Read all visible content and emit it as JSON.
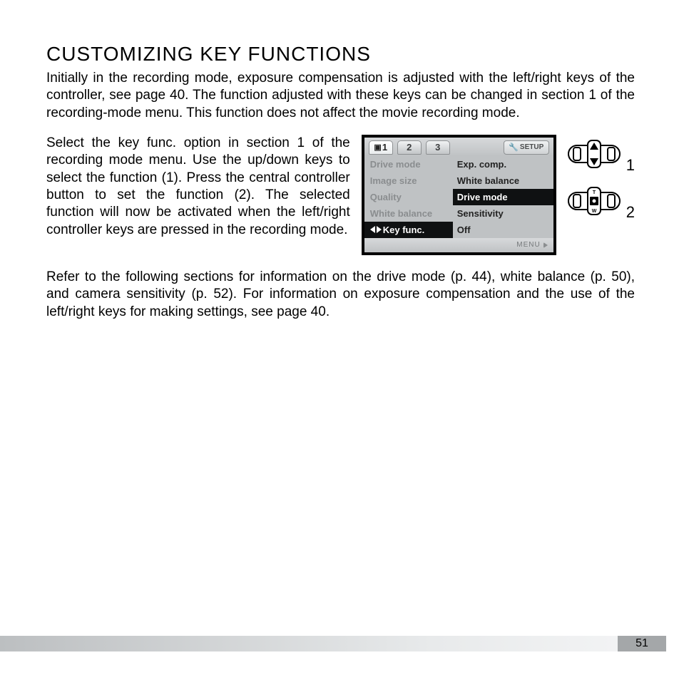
{
  "heading": "CUSTOMIZING KEY FUNCTIONS",
  "intro": "Initially in the recording mode, exposure compensation is adjusted with the left/right keys of the controller, see page 40. The function adjusted with these keys can be changed in section 1 of the recording-mode menu. This function does not affect the movie recording mode.",
  "side_text": "Select the key func. option in section 1 of the recording mode menu. Use the up/down keys to select the function (1). Press the central controller button to set the function (2). The selected function will now be activated when the left/right controller keys are pressed in the recording mode.",
  "after_text": "Refer to the following sections for information on the drive mode (p. 44), white balance (p. 50), and camera sensitivity (p. 52). For information on exposure compensation and the use of the left/right keys for making settings, see page 40.",
  "page_number": "51",
  "lcd": {
    "tabs": {
      "t1": "1",
      "t2": "2",
      "t3": "3"
    },
    "setup_label": "SETUP",
    "menu_label": "MENU",
    "rows": {
      "r0": {
        "left": "Drive mode",
        "right": "Exp. comp."
      },
      "r1": {
        "left": "Image size",
        "right": "White balance"
      },
      "r2": {
        "left": "Quality",
        "right": "Drive mode"
      },
      "r3": {
        "left": "White balance",
        "right": "Sensitivity"
      },
      "r4": {
        "left": "Key func.",
        "right": "Off"
      }
    }
  },
  "callouts": {
    "n1": "1",
    "n2": "2"
  }
}
